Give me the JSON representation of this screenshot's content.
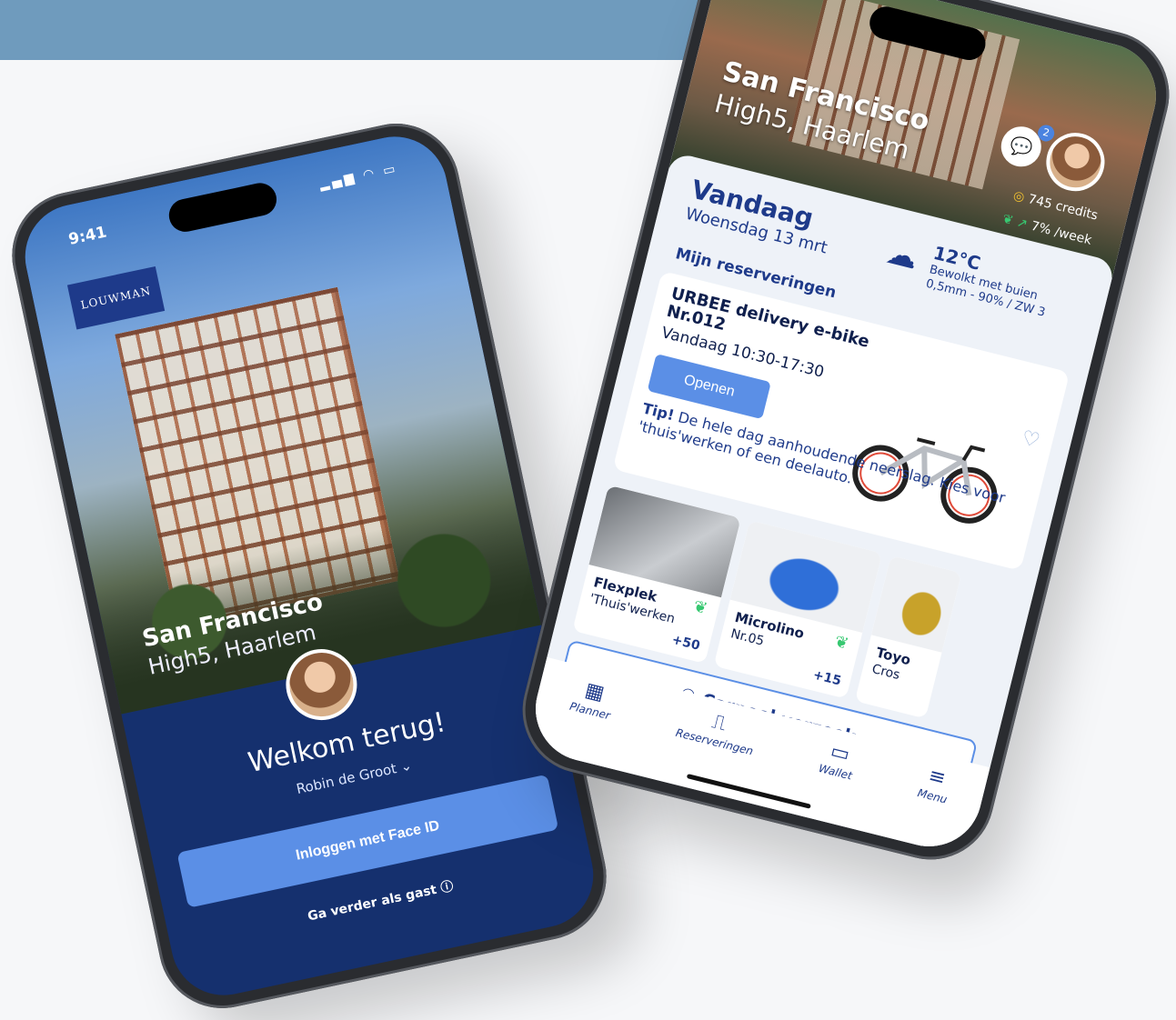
{
  "left_phone": {
    "status_time": "9:41",
    "logo": "LOUWMAN",
    "location_title": "San Francisco",
    "location_subtitle": "High5, Haarlem",
    "welcome": "Welkom terug!",
    "user_name": "Robin de Groot ⌄",
    "faceid_button": "Inloggen met Face ID",
    "guest_link": "Ga verder als gast ⓘ"
  },
  "right_phone": {
    "location_title": "San Francisco",
    "location_subtitle": "High5, Haarlem",
    "chat_badge": "2",
    "credits": "745 credits",
    "week": "7% /week",
    "today_title": "Vandaag",
    "today_date": "Woensdag 13 mrt",
    "temperature": "12°C",
    "weather_desc": "Bewolkt met buien",
    "weather_detail": "0,5mm - 90% / ZW 3",
    "reservations_heading": "Mijn reserveringen",
    "reservation": {
      "name_line1": "URBEE delivery e-bike",
      "name_line2": "Nr.012",
      "time": "Vandaag 10:30-17:30",
      "open_button": "Openen"
    },
    "tip_bold": "Tip!",
    "tip_text": " De hele dag aanhoudende neerslag. Kies voor 'thuis'werken of een deelauto.",
    "tiles": [
      {
        "name": "Flexplek",
        "sub": "'Thuis'werken",
        "score": "+50"
      },
      {
        "name": "Microlino",
        "sub": "Nr.05",
        "score": "+15"
      },
      {
        "name": "Toyo",
        "sub": "Cros"
      }
    ],
    "carpool_button": "Carpool verzoek",
    "nav": [
      {
        "label": "Planner"
      },
      {
        "label": "Reserveringen"
      },
      {
        "label": "Wallet"
      },
      {
        "label": "Menu"
      }
    ]
  },
  "colors": {
    "brand_dark": "#15306e",
    "brand_accent": "#5b8fe6",
    "top_band": "#6f9bbd",
    "eco_green": "#37c871",
    "coin_yellow": "#f2c230"
  }
}
